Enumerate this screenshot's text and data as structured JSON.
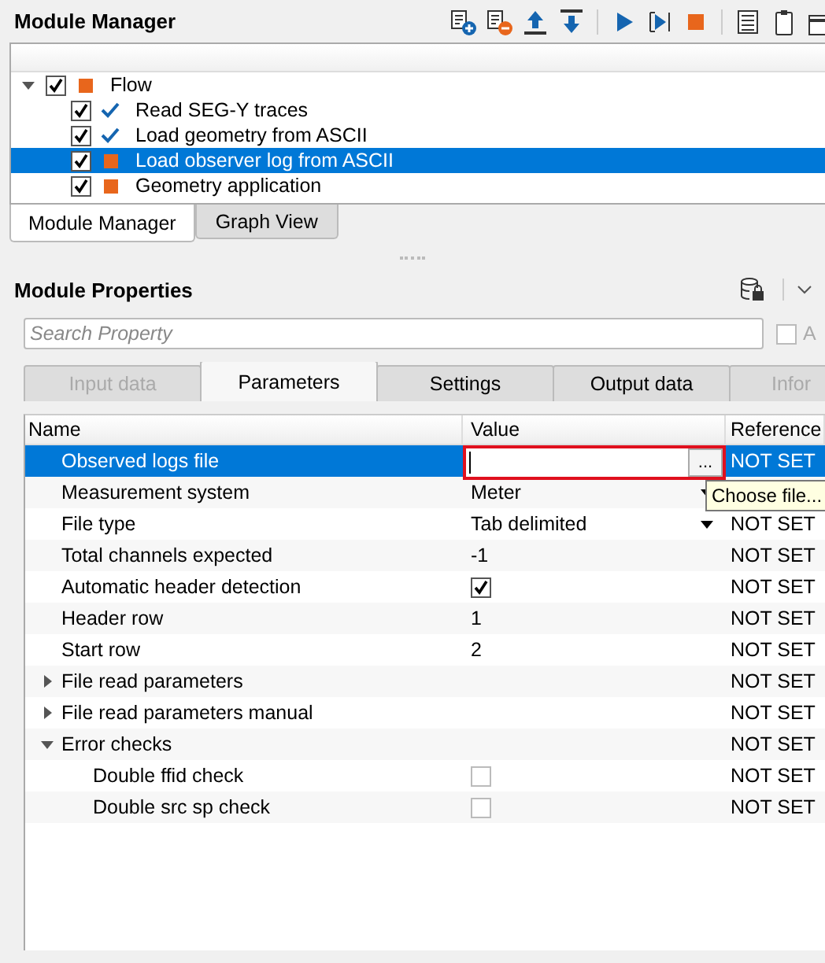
{
  "module_manager": {
    "title": "Module Manager",
    "tree": [
      {
        "label": "Flow",
        "checked": true,
        "kind": "pending",
        "expanded": true,
        "selected": false,
        "children": [
          {
            "label": "Read SEG-Y traces",
            "checked": true,
            "kind": "done",
            "selected": false
          },
          {
            "label": "Load geometry from ASCII",
            "checked": true,
            "kind": "done",
            "selected": false
          },
          {
            "label": "Load observer log from ASCII",
            "checked": true,
            "kind": "pending",
            "selected": true
          },
          {
            "label": "Geometry application",
            "checked": true,
            "kind": "pending",
            "selected": false
          }
        ]
      }
    ],
    "tabs": [
      {
        "label": "Module Manager",
        "selected": true
      },
      {
        "label": "Graph View",
        "selected": false
      }
    ]
  },
  "module_properties": {
    "title": "Module Properties",
    "search": {
      "placeholder": "Search Property"
    },
    "option": {
      "label": "A",
      "checked": false
    },
    "tabs": [
      {
        "label": "Input data",
        "selected": false,
        "disabled": true
      },
      {
        "label": "Parameters",
        "selected": true,
        "disabled": false
      },
      {
        "label": "Settings",
        "selected": false,
        "disabled": false
      },
      {
        "label": "Output data",
        "selected": false,
        "disabled": false
      },
      {
        "label": "Infor",
        "selected": false,
        "disabled": true
      }
    ],
    "table": {
      "columns": [
        "Name",
        "Value",
        "Reference"
      ],
      "rows": [
        {
          "name": "Observed logs file",
          "kind": "file",
          "value": "",
          "button": "...",
          "reference": "NOT SET",
          "selected": true,
          "highlighted": true,
          "tooltip": "Choose file..."
        },
        {
          "name": "Measurement system",
          "kind": "dropdown",
          "value": "Meter",
          "selected": false
        },
        {
          "name": "File type",
          "kind": "dropdown",
          "value": "Tab delimited",
          "reference": "NOT SET",
          "selected": false
        },
        {
          "name": "Total channels expected",
          "kind": "text",
          "value": "-1",
          "reference": "NOT SET",
          "selected": false
        },
        {
          "name": "Automatic header detection",
          "kind": "checkbox",
          "checked": true,
          "reference": "NOT SET",
          "selected": false
        },
        {
          "name": "Header row",
          "kind": "text",
          "value": "1",
          "reference": "NOT SET",
          "selected": false
        },
        {
          "name": "Start row",
          "kind": "text",
          "value": "2",
          "reference": "NOT SET",
          "selected": false
        },
        {
          "name": "File read parameters",
          "kind": "group",
          "expanded": false,
          "reference": "NOT SET",
          "selected": false
        },
        {
          "name": "File read parameters manual",
          "kind": "group",
          "expanded": false,
          "reference": "NOT SET",
          "selected": false
        },
        {
          "name": "Error checks",
          "kind": "group",
          "expanded": true,
          "reference": "NOT SET",
          "selected": false,
          "children": [
            {
              "name": "Double ffid check",
              "kind": "checkbox",
              "checked": false,
              "reference": "NOT SET",
              "selected": false
            },
            {
              "name": "Double src sp check",
              "kind": "checkbox",
              "checked": false,
              "reference": "NOT SET",
              "selected": false
            }
          ]
        }
      ]
    }
  }
}
